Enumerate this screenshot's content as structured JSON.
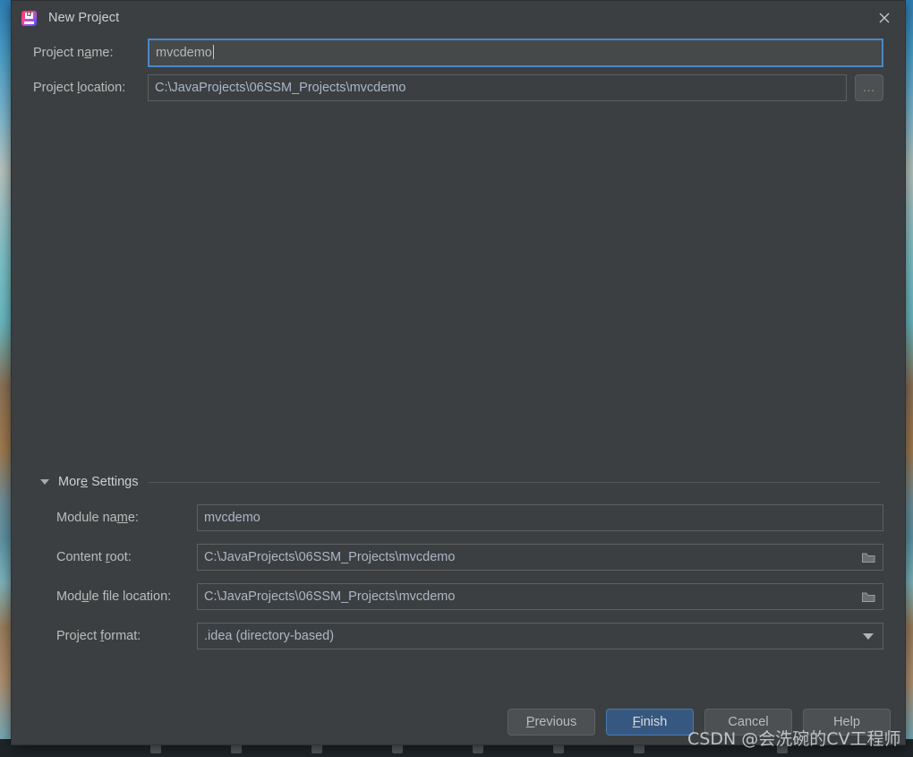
{
  "window": {
    "title": "New Project",
    "app_icon": "intellij-idea-icon",
    "icon_text": "IJ",
    "close_icon": "close-icon"
  },
  "top_form": {
    "project_name": {
      "label": "Project name:",
      "label_pre": "Project n",
      "label_mnemonic": "a",
      "label_post": "me:",
      "value": "mvcdemo",
      "focused": true
    },
    "project_location": {
      "label": "Project location:",
      "label_pre": "Project ",
      "label_mnemonic": "l",
      "label_post": "ocation:",
      "value": "C:\\JavaProjects\\06SSM_Projects\\mvcdemo",
      "browse_button_label": "...",
      "browse_icon": "ellipsis-icon"
    }
  },
  "more_settings": {
    "header_label": "More Settings",
    "header_pre": "Mor",
    "header_mnemonic": "e",
    "header_post": " Settings",
    "expanded": true,
    "collapse_icon": "triangle-down-icon",
    "rows": [
      {
        "label": "Module name:",
        "label_pre": "Module na",
        "label_mnemonic": "m",
        "label_post": "e:",
        "value": "mvcdemo",
        "widget": "textfield",
        "icon": null
      },
      {
        "label": "Content root:",
        "label_pre": "Content ",
        "label_mnemonic": "r",
        "label_post": "oot:",
        "value": "C:\\JavaProjects\\06SSM_Projects\\mvcdemo",
        "widget": "textfield",
        "icon": "folder-icon"
      },
      {
        "label": "Module file location:",
        "label_pre": "Mod",
        "label_mnemonic": "u",
        "label_post": "le file location:",
        "value": "C:\\JavaProjects\\06SSM_Projects\\mvcdemo",
        "widget": "textfield",
        "icon": "folder-icon"
      },
      {
        "label": "Project format:",
        "label_pre": "Project ",
        "label_mnemonic": "f",
        "label_post": "ormat:",
        "value": ".idea (directory-based)",
        "widget": "combobox",
        "icon": "chevron-down-icon"
      }
    ]
  },
  "buttons": [
    {
      "name": "previous",
      "label": "Previous",
      "pre": "",
      "mnemonic": "P",
      "post": "revious",
      "default": false
    },
    {
      "name": "finish",
      "label": "Finish",
      "pre": "",
      "mnemonic": "F",
      "post": "inish",
      "default": true
    },
    {
      "name": "cancel",
      "label": "Cancel",
      "pre": "Cancel",
      "mnemonic": "",
      "post": "",
      "default": false
    },
    {
      "name": "help",
      "label": "Help",
      "pre": "Help",
      "mnemonic": "",
      "post": "",
      "default": false
    }
  ],
  "watermark": {
    "text": "CSDN @会洗碗的CV工程师"
  },
  "colors": {
    "dialog_background": "#3c3f41",
    "field_border": "#5e6060",
    "focus_border": "#4a88c7",
    "default_button": "#365880",
    "text": "#bbbbbb",
    "field_text": "#a9b7c6"
  }
}
